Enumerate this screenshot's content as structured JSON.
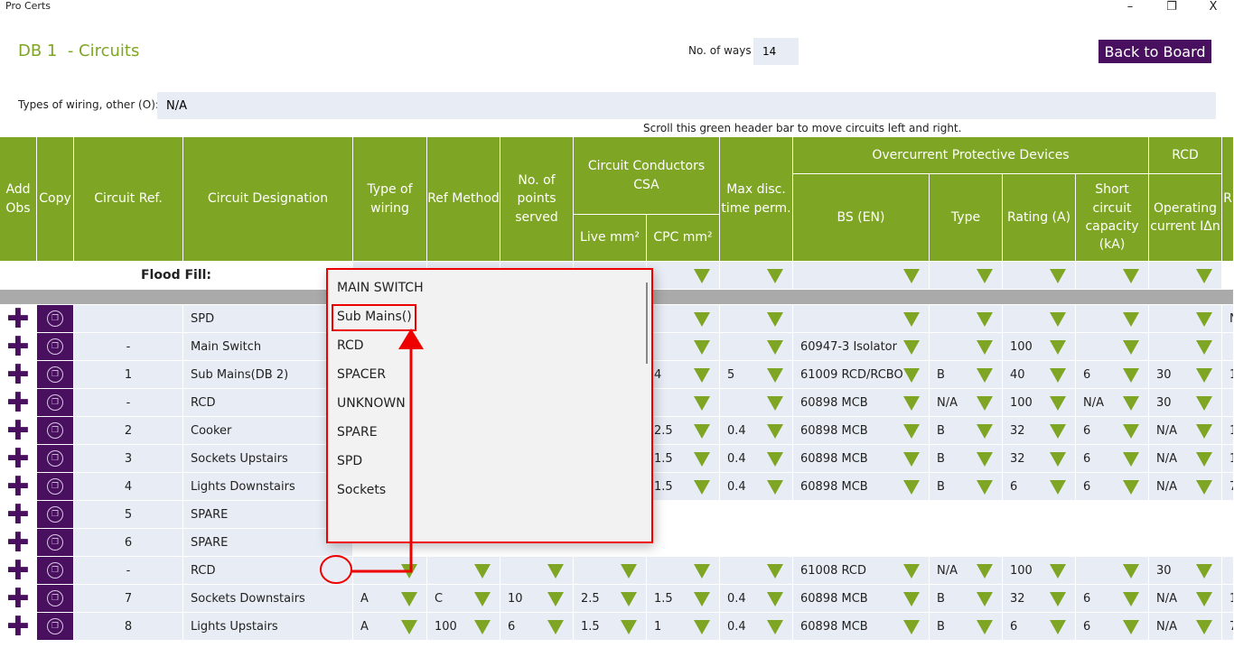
{
  "window": {
    "title": "Pro Certs",
    "minimize": "–",
    "restore": "❐",
    "close": "X"
  },
  "header": {
    "title": "DB 1  - Circuits",
    "ways_label": "No. of ways",
    "ways_value": "14",
    "back_button": "Back to Board"
  },
  "wiring": {
    "label": "Types of wiring, other (O):",
    "value": "N/A"
  },
  "scroll_hint": "Scroll this green header bar to move circuits left and right.",
  "table": {
    "headers": {
      "add_obs": "Add Obs",
      "copy": "Copy",
      "circuit_ref": "Circuit Ref.",
      "designation": "Circuit Designation",
      "type_wiring": "Type of wiring",
      "ref_method": "Ref Method",
      "points": "No. of points served",
      "conductors": "Circuit Conductors CSA",
      "live": "Live mm²",
      "cpc": "CPC mm²",
      "max_disc": "Max disc. time perm.",
      "ocpd": "Overcurrent Protective Devices",
      "bs": "BS (EN)",
      "type": "Type",
      "rating": "Rating (A)",
      "short": "Short circuit capacity (kA)",
      "rcd": "RCD",
      "rcd_op": "Operating current IΔn",
      "next": "R"
    },
    "flood_fill": "Flood Fill:",
    "rows": [
      {
        "ref": "",
        "des": "SPD",
        "v": [
          "",
          "",
          "",
          "",
          "",
          "",
          "",
          "",
          "",
          "",
          "",
          "N/A"
        ]
      },
      {
        "ref": "-",
        "des": "Main Switch",
        "v": [
          "",
          "",
          "",
          "",
          "",
          "",
          "60947-3 Isolator",
          "",
          "100",
          "",
          "",
          ""
        ]
      },
      {
        "ref": "1",
        "des": "Sub Mains(DB 2)",
        "v": [
          "",
          "",
          "",
          "",
          "4",
          "5",
          "61009 RCD/RCBO",
          "B",
          "40",
          "6",
          "30",
          "1"
        ]
      },
      {
        "ref": "-",
        "des": "RCD",
        "v": [
          "",
          "",
          "",
          "",
          "",
          "",
          "60898 MCB",
          "N/A",
          "100",
          "N/A",
          "30",
          ""
        ]
      },
      {
        "ref": "2",
        "des": "Cooker",
        "v": [
          "",
          "",
          "",
          "",
          "2.5",
          "0.4",
          "60898 MCB",
          "B",
          "32",
          "6",
          "N/A",
          "1"
        ]
      },
      {
        "ref": "3",
        "des": "Sockets Upstairs",
        "v": [
          "",
          "",
          "",
          "",
          "1.5",
          "0.4",
          "60898 MCB",
          "B",
          "32",
          "6",
          "N/A",
          "1"
        ]
      },
      {
        "ref": "4",
        "des": "Lights Downstairs",
        "v": [
          "",
          "",
          "",
          "",
          "1.5",
          "0.4",
          "60898 MCB",
          "B",
          "6",
          "6",
          "N/A",
          "7"
        ]
      },
      {
        "ref": "5",
        "des": "SPARE",
        "spare": true,
        "v": []
      },
      {
        "ref": "6",
        "des": "SPARE",
        "spare": true,
        "v": []
      },
      {
        "ref": "-",
        "des": "RCD",
        "v": [
          "",
          "",
          "",
          "",
          "",
          "",
          "61008 RCD",
          "N/A",
          "100",
          "",
          "30",
          ""
        ]
      },
      {
        "ref": "7",
        "des": "Sockets Downstairs",
        "v": [
          "A",
          "C",
          "10",
          "2.5",
          "1.5",
          "0.4",
          "60898 MCB",
          "B",
          "32",
          "6",
          "N/A",
          "1"
        ]
      },
      {
        "ref": "8",
        "des": "Lights Upstairs",
        "v": [
          "A",
          "100",
          "6",
          "1.5",
          "1",
          "0.4",
          "60898 MCB",
          "B",
          "6",
          "6",
          "N/A",
          "7"
        ]
      }
    ]
  },
  "dropdown": {
    "items": [
      "MAIN SWITCH",
      "Sub Mains()",
      "RCD",
      "SPACER",
      "UNKNOWN",
      "SPARE",
      "SPD",
      "Sockets"
    ],
    "highlighted": "Sub Mains()"
  },
  "colors": {
    "accent": "#7ea524",
    "brand": "#4a1060",
    "annotation": "#e00000"
  }
}
